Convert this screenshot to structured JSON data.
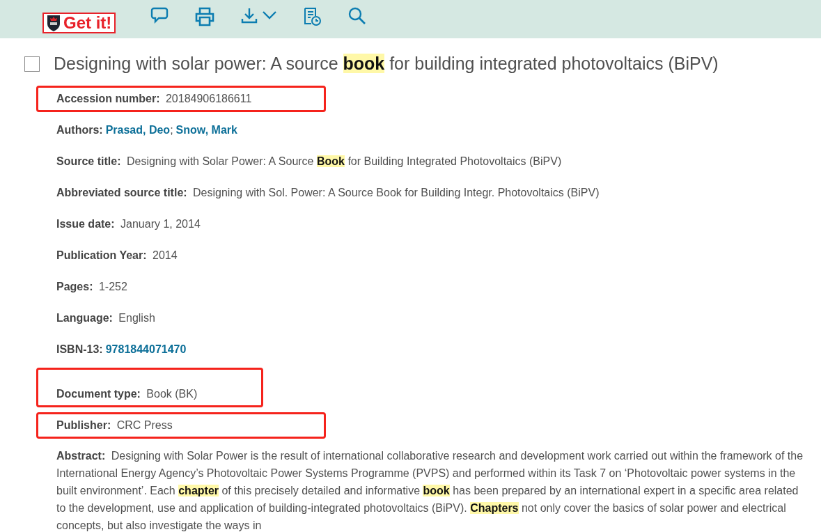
{
  "toolbar": {
    "logo_text": "Get it!"
  },
  "record": {
    "checked": false,
    "title": "Designing with solar power: A source **book** for building integrated photovoltaics (BiPV)",
    "fields": [
      {
        "kind": "text",
        "label": "Accession number:",
        "value": "20184906186611",
        "boxed": true
      },
      {
        "kind": "links",
        "label": "Authors:",
        "links": [
          "Prasad, Deo",
          "Snow, Mark"
        ],
        "separator": ";",
        "boxed": false
      },
      {
        "kind": "text",
        "label": "Source title:",
        "value": "Designing with Solar Power: A Source **Book** for Building Integrated Photovoltaics (BiPV)",
        "boxed": false
      },
      {
        "kind": "text",
        "label": "Abbreviated source title:",
        "value": "Designing with Sol. Power: A Source Book for Building Integr. Photovoltaics (BiPV)",
        "boxed": false
      },
      {
        "kind": "text",
        "label": "Issue date:",
        "value": "January 1, 2014",
        "boxed": false
      },
      {
        "kind": "text",
        "label": "Publication Year:",
        "value": "2014",
        "boxed": false
      },
      {
        "kind": "text",
        "label": "Pages:",
        "value": "1-252",
        "boxed": false
      },
      {
        "kind": "text",
        "label": "Language:",
        "value": "English",
        "boxed": false
      },
      {
        "kind": "link",
        "label": "ISBN-13:",
        "value": "9781844071470",
        "boxed": false
      },
      {
        "kind": "text",
        "label": "Document type:",
        "value": "Book (BK)",
        "boxed": true
      },
      {
        "kind": "text",
        "label": "Publisher:",
        "value": "CRC Press",
        "boxed": true
      },
      {
        "kind": "abstract",
        "label": "Abstract:",
        "value": "Designing with Solar Power is the result of international collaborative research and development work carried out within the framework of the International Energy Agency’s Photovoltaic Power Systems Programme (PVPS) and performed within its Task 7 on ‘Photovoltaic power systems in the built environment’. Each **chapter** of this precisely detailed and informative **book** has been prepared by an international expert in a specific area related to the development, use and application of building-integrated photovoltaics (BiPV). **Chapters** not only cover the basics of solar power and electrical concepts, but also investigate the ways in",
        "boxed": false
      }
    ]
  }
}
